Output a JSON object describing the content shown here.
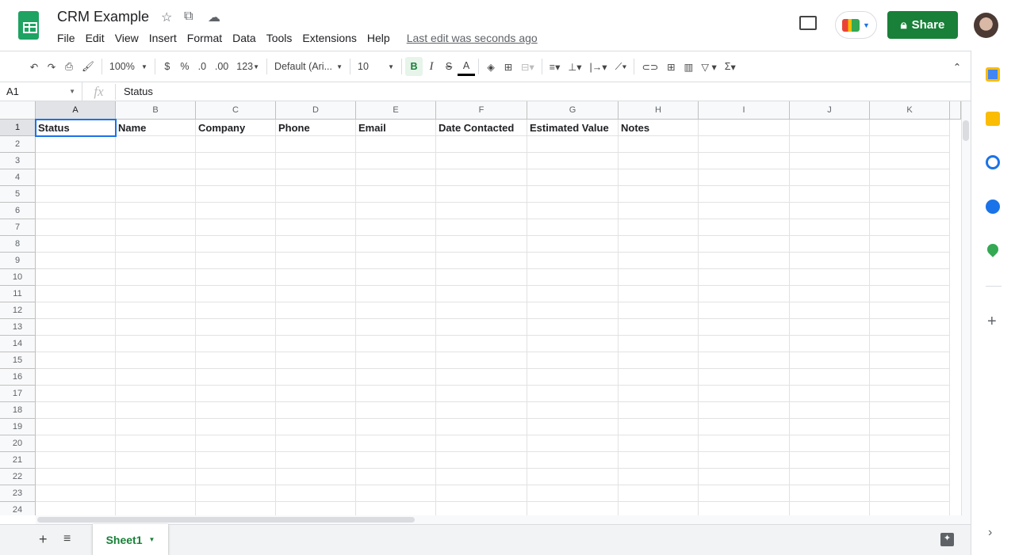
{
  "doc": {
    "title": "CRM Example",
    "last_edit": "Last edit was seconds ago"
  },
  "menu": [
    "File",
    "Edit",
    "View",
    "Insert",
    "Format",
    "Data",
    "Tools",
    "Extensions",
    "Help"
  ],
  "share_label": "Share",
  "toolbar": {
    "zoom": "100%",
    "currency": "$",
    "percent": "%",
    "dec_less": ".0",
    "dec_more": ".00",
    "more_formats": "123",
    "font": "Default (Ari...",
    "font_size": "10",
    "bold": "B",
    "italic": "I",
    "strike": "S",
    "text_color": "A",
    "sum": "Σ"
  },
  "formula_bar": {
    "name_box": "A1",
    "fx": "fx",
    "value": "Status"
  },
  "columns": [
    "A",
    "B",
    "C",
    "D",
    "E",
    "F",
    "G",
    "H",
    "I",
    "J",
    "K"
  ],
  "header_row": [
    "Status",
    "Name",
    "Company",
    "Phone",
    "Email",
    "Date Contacted",
    "Estimated Value",
    "Notes",
    "",
    "",
    ""
  ],
  "row_count": 24,
  "sheet": {
    "tab": "Sheet1"
  },
  "colors": {
    "accent": "#188038",
    "selection": "#1a73e8"
  }
}
